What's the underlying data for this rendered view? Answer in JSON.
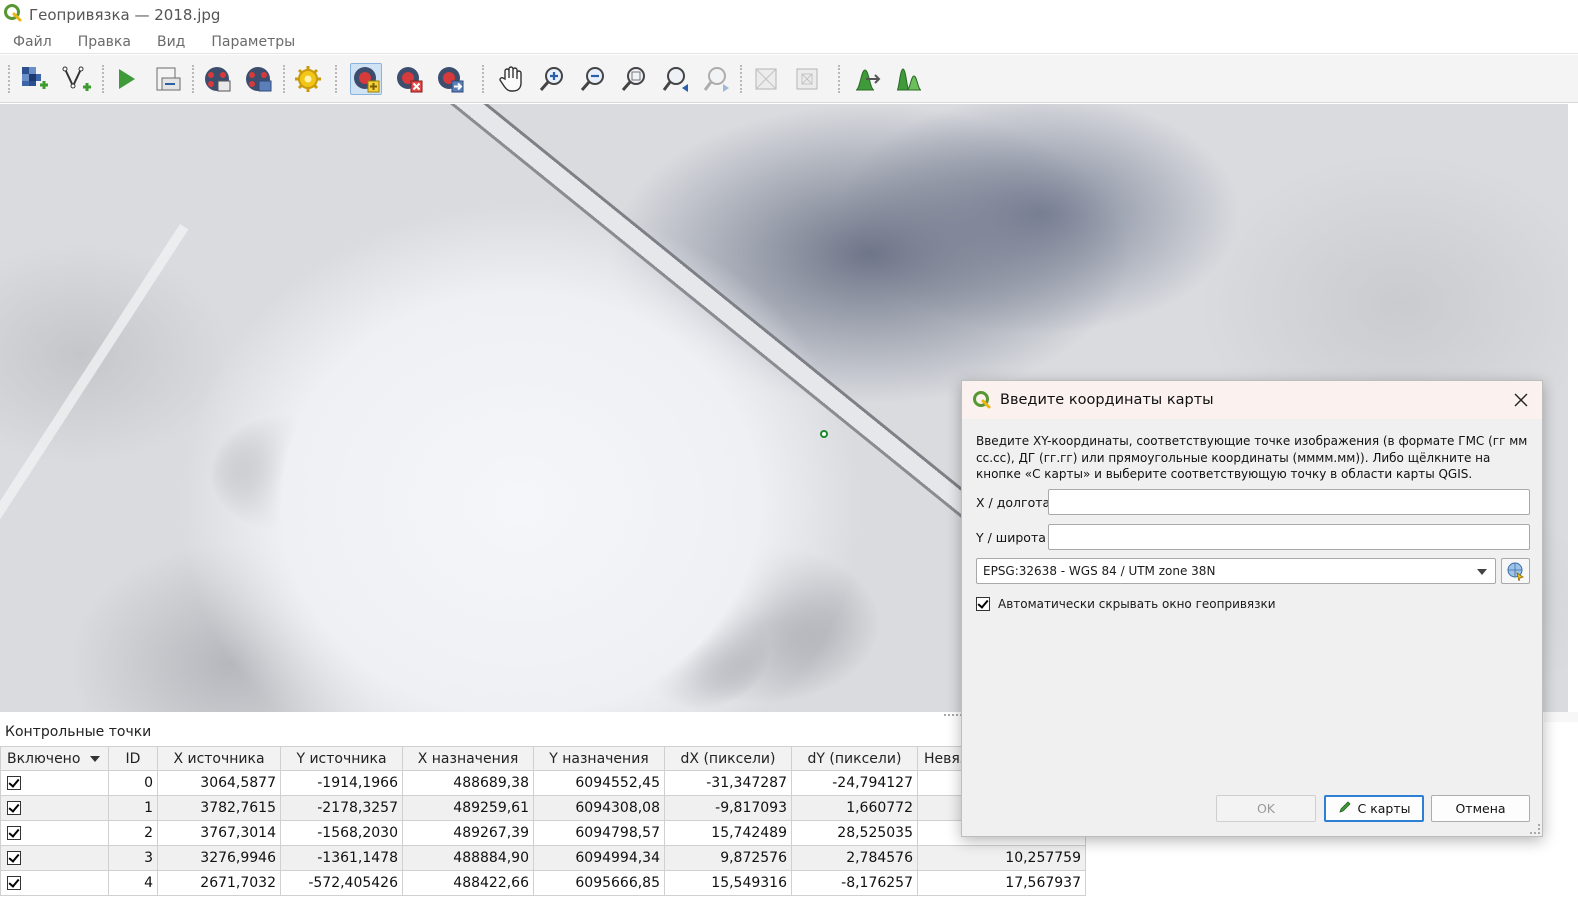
{
  "window": {
    "title": "Геопривязка — 2018.jpg",
    "logo_icon": "qgis-logo-icon"
  },
  "menu": [
    "Файл",
    "Правка",
    "Вид",
    "Параметры"
  ],
  "toolbar": {
    "icons": [
      "open-raster-icon",
      "open-vector-icon",
      "start-georeferencing-icon",
      "generate-gdal-script-icon",
      "load-gcp-points-icon",
      "save-gcp-points-icon",
      "transformation-settings-icon",
      "add-point-icon",
      "delete-point-icon",
      "move-point-icon",
      "pan-icon",
      "zoom-in-icon",
      "zoom-out-icon",
      "zoom-to-layer-icon",
      "zoom-last-icon",
      "zoom-next-icon",
      "link-georeferencer-icon",
      "link-qgis-icon",
      "full-histogram-stretch-icon",
      "local-histogram-stretch-icon"
    ],
    "active": "add-point-icon"
  },
  "gcp_panel": {
    "title": "Контрольные точки",
    "columns": [
      "Включено",
      "ID",
      "X источника",
      "Y источника",
      "X назначения",
      "Y назначения",
      "dX (пиксели)",
      "dY (пиксели)",
      "Невязка (пиксели)"
    ],
    "rows": [
      {
        "enabled": true,
        "id": "0",
        "src_x": "3064,5877",
        "src_y": "-1914,1966",
        "dst_x": "488689,38",
        "dst_y": "6094552,45",
        "dx": "-31,347287",
        "dy": "-24,794127",
        "residual": ""
      },
      {
        "enabled": true,
        "id": "1",
        "src_x": "3782,7615",
        "src_y": "-2178,3257",
        "dst_x": "489259,61",
        "dst_y": "6094308,08",
        "dx": "-9,817093",
        "dy": "1,660772",
        "residual": ""
      },
      {
        "enabled": true,
        "id": "2",
        "src_x": "3767,3014",
        "src_y": "-1568,2030",
        "dst_x": "489267,39",
        "dst_y": "6094798,57",
        "dx": "15,742489",
        "dy": "28,525035",
        "residual": ""
      },
      {
        "enabled": true,
        "id": "3",
        "src_x": "3276,9946",
        "src_y": "-1361,1478",
        "dst_x": "488884,90",
        "dst_y": "6094994,34",
        "dx": "9,872576",
        "dy": "2,784576",
        "residual": "10,257759"
      },
      {
        "enabled": true,
        "id": "4",
        "src_x": "2671,7032",
        "src_y": "-572,405426",
        "dst_x": "488422,66",
        "dst_y": "6095666,85",
        "dx": "15,549316",
        "dy": "-8,176257",
        "residual": "17,567937"
      }
    ]
  },
  "dialog": {
    "title": "Введите координаты карты",
    "instructions": "Введите XY-координаты, соответствующие точке изображения (в формате ГМС (гг мм сс.сс), ДГ (гг.гг) или прямоугольные координаты (мммм.мм)). Либо щёлкните на кнопке «С карты» и выберите соответствующую точку в области карты QGIS.",
    "x_label": "X / долгота",
    "x_value": "",
    "y_label": "Y / широта",
    "y_value": "",
    "crs": "EPSG:32638 - WGS 84 / UTM zone 38N",
    "auto_hide_label": "Автоматически скрывать окно геопривязки",
    "auto_hide_checked": true,
    "ok_label": "OK",
    "from_map_label": "С карты",
    "cancel_label": "Отмена"
  }
}
